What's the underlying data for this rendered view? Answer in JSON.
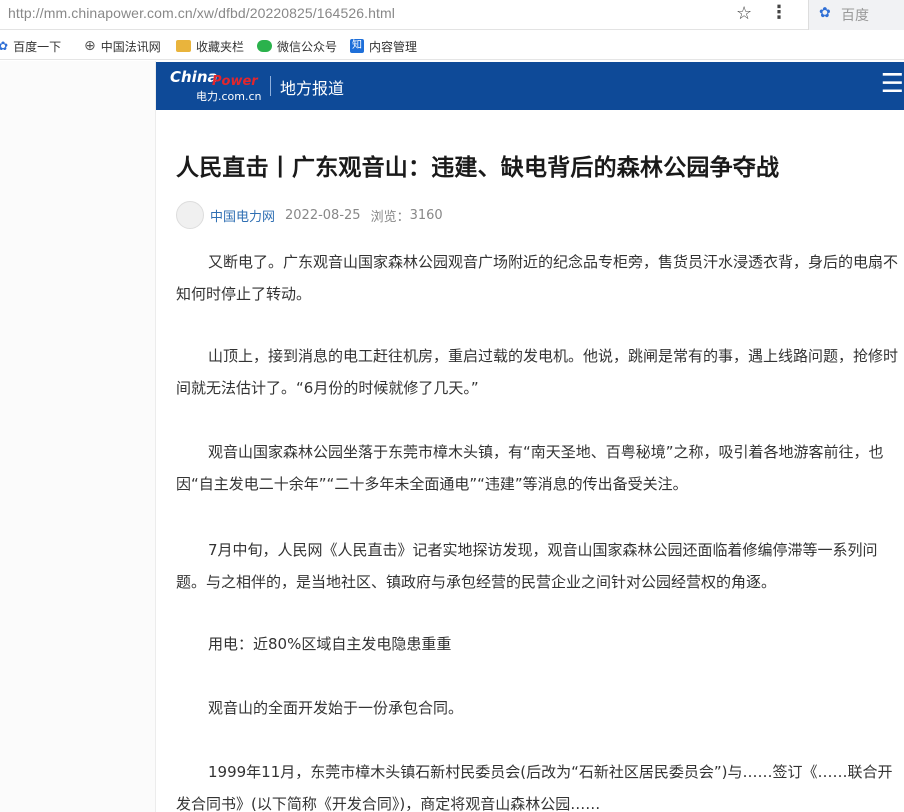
{
  "browser": {
    "url": "http://mm.chinapower.com.cn/xw/dfbd/20220825/164526.html",
    "search_placeholder": "百度"
  },
  "bookmarks": [
    {
      "label": "百度一下"
    },
    {
      "label": "中国法讯网"
    },
    {
      "label": "收藏夹栏"
    },
    {
      "label": "微信公众号"
    },
    {
      "label": "内容管理"
    }
  ],
  "header": {
    "logo_line1": "China",
    "logo_line2": "Power",
    "logo_line3": "电力.com.cn",
    "section": "地方报道"
  },
  "article": {
    "title": "人民直击丨广东观音山：违建、缺电背后的森林公园争夺战",
    "source": "中国电力网",
    "date": "2022-08-25",
    "views_label": "浏览：",
    "views": "3160",
    "paragraphs": [
      "又断电了。广东观音山国家森林公园观音广场附近的纪念品专柜旁，售货员汗水浸透衣背，身后的电扇不知何时停止了转动。",
      "山顶上，接到消息的电工赶往机房，重启过载的发电机。他说，跳闸是常有的事，遇上线路问题，抢修时间就无法估计了。“6月份的时候就修了几天。”",
      "观音山国家森林公园坐落于东莞市樟木头镇，有“南天圣地、百粤秘境”之称，吸引着各地游客前往，也因“自主发电二十余年”“二十多年未全面通电”“违建”等消息的传出备受关注。",
      "7月中旬，人民网《人民直击》记者实地探访发现，观音山国家森林公园还面临着修编停滞等一系列问题。与之相伴的，是当地社区、镇政府与承包经营的民营企业之间针对公园经营权的角逐。",
      "用电：近80%区域自主发电隐患重重",
      "观音山的全面开发始于一份承包合同。",
      "1999年11月，东莞市樟木头镇石新村民委员会(后改为“石新社区居民委员会”)与……签订《……联合开发合同书》(以下简称《开发合同》)，商定将观音山森林公园……"
    ]
  },
  "colors": {
    "header_bg": "#0e4a98",
    "source_link": "#2f6fb3",
    "logo_red": "#e2262d"
  }
}
